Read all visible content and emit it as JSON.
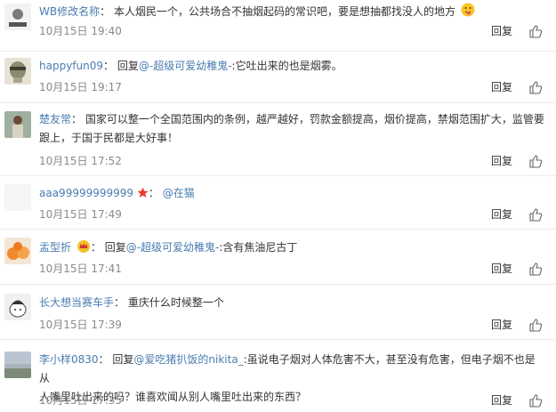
{
  "reply_label": "回复",
  "comments": [
    {
      "user": "WB修改名称",
      "content": "本人烟民一个，公共场合不抽烟起码的常识吧，要是想抽都找没人的地方",
      "time": "10月15日 19:40"
    },
    {
      "user": "happyfun09",
      "prefix": "回复",
      "mention": "@-超级可爱幼稚鬼-",
      "content": ":它吐出来的也是烟雾。",
      "time": "10月15日 19:17"
    },
    {
      "user": "楚友常",
      "content_line1": "国家可以整一个全国范围内的条例，越严越好，罚款金额提高，烟价提高，禁烟范围扩大，监管要",
      "content_line2": "跟上，于国于民都是大好事！",
      "time": "10月15日 17:52"
    },
    {
      "user": "aaa99999999999",
      "mention": "@在猫",
      "time": "10月15日 17:49"
    },
    {
      "user": "盂型折",
      "prefix": "回复",
      "mention": "@-超级可爱幼稚鬼-",
      "content": ":含有焦油尼古丁",
      "time": "10月15日 17:41"
    },
    {
      "user": "长大想当赛车手",
      "content": "重庆什么时候整一个",
      "time": "10月15日 17:39"
    },
    {
      "user": "李小样0830",
      "prefix": "回复",
      "mention": "@爱吃猪扒饭的nikita_",
      "content_line1": ":虽说电子烟对人体危害不大，甚至没有危害，但电子烟不也是从",
      "content_line2": "人嘴里吐出来的吗？谁喜欢闻从别人嘴里吐出来的东西？",
      "time": "10月15日 17:35"
    }
  ]
}
